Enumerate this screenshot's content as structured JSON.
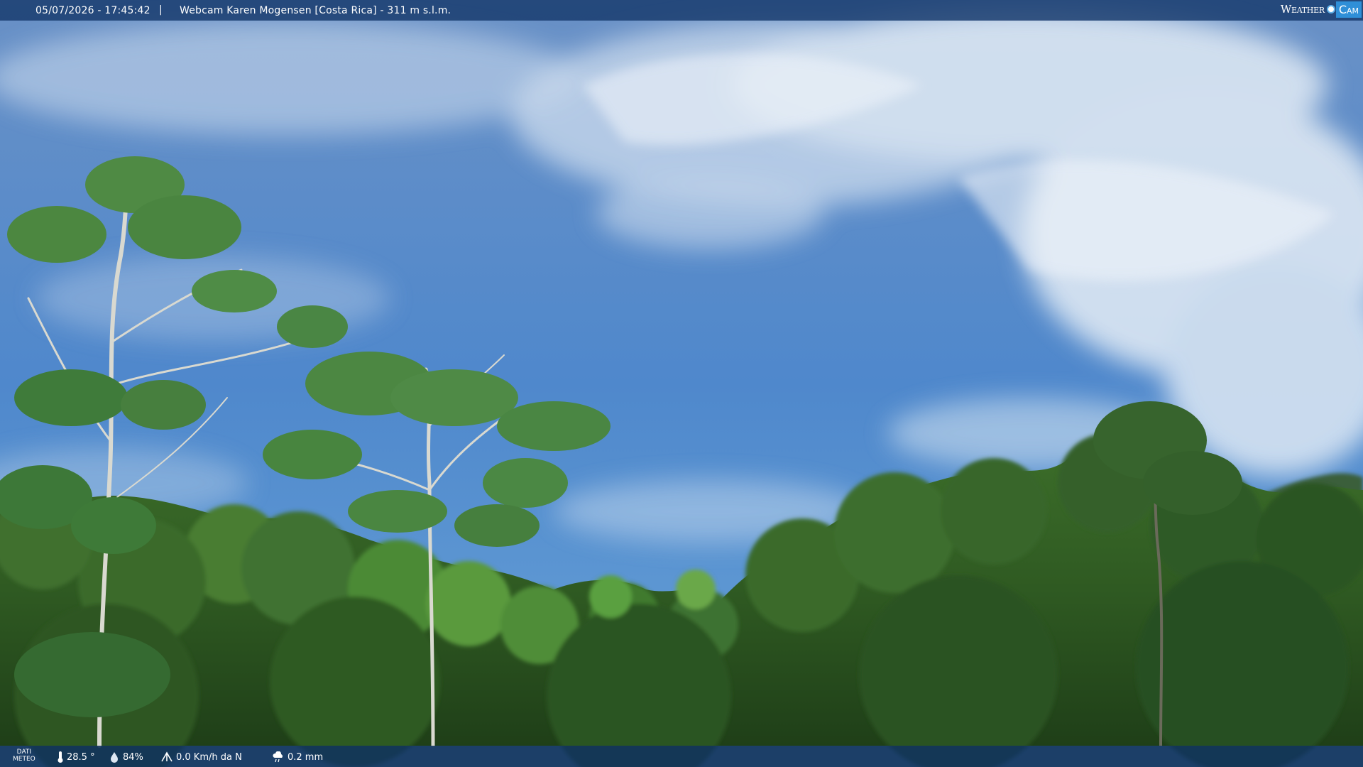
{
  "overlay": {
    "datetime": "05/07/2026 - 17:45:42",
    "separator": "|",
    "title": "Webcam Karen Mogensen [Costa Rica] - 311 m s.l.m.",
    "logo_weather": "Weather",
    "logo_cam": "Cam"
  },
  "meteo": {
    "label_line1": "DATI",
    "label_line2": "METEO",
    "temperature": "28.5 °",
    "humidity": "84%",
    "wind": "0.0 Km/h da N",
    "rain": "0.2 mm"
  },
  "icons": [
    "thermometer-icon",
    "humidity-drop-icon",
    "wind-icon",
    "rain-cloud-icon"
  ],
  "colors": {
    "sky_top": "#5b86bf",
    "sky_bottom": "#4d8fd4",
    "bar": "#1e4475",
    "accent": "#2f8fd8"
  }
}
